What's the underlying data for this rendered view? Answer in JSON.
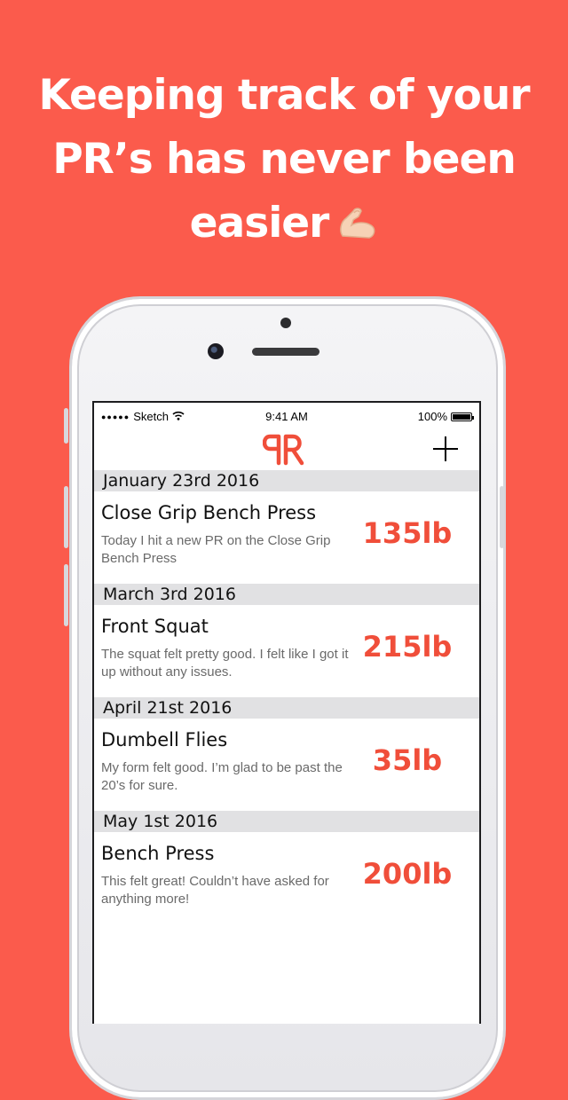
{
  "headline": {
    "line1": "Keeping track of your",
    "line2": "PR’s has never been",
    "line3": "easier"
  },
  "icons": {
    "headline_emoji": "flexed-biceps-icon",
    "logo": "pr-logo-icon",
    "add": "plus-icon",
    "wifi": "wifi-icon",
    "battery": "battery-icon"
  },
  "colors": {
    "background": "#fb5b4c",
    "accent": "#f04e3a",
    "section_bg": "#e1e1e3"
  },
  "status_bar": {
    "carrier": "Sketch",
    "time": "9:41 AM",
    "battery": "100%"
  },
  "entries": [
    {
      "date": "January 23rd 2016",
      "exercise": "Close Grip Bench Press",
      "note": "Today I hit a new PR on the Close Grip Bench Press",
      "weight": "135lb"
    },
    {
      "date": "March 3rd 2016",
      "exercise": "Front Squat",
      "note": "The squat felt pretty good. I felt like I got it up without any issues.",
      "weight": "215lb"
    },
    {
      "date": "April 21st 2016",
      "exercise": "Dumbell Flies",
      "note": "My form felt good. I’m glad to be past the 20’s for sure.",
      "weight": "35lb"
    },
    {
      "date": "May 1st 2016",
      "exercise": "Bench Press",
      "note": "This felt great! Couldn’t have asked for anything more!",
      "weight": "200lb"
    }
  ]
}
